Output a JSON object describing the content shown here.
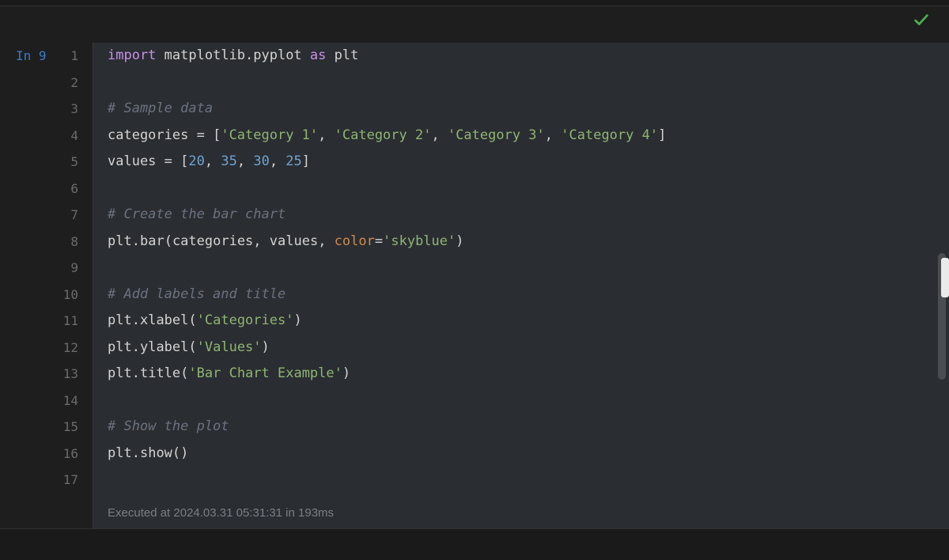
{
  "cell": {
    "prompt": "In 9",
    "execution_status": "Executed at 2024.03.31 05:31:31 in 193ms"
  },
  "gutter": {
    "lines": [
      "1",
      "2",
      "3",
      "4",
      "5",
      "6",
      "7",
      "8",
      "9",
      "10",
      "11",
      "12",
      "13",
      "14",
      "15",
      "16",
      "17"
    ]
  },
  "code": {
    "line1": {
      "kw_import": "import",
      "module": "matplotlib.pyplot",
      "kw_as": "as",
      "alias": "plt"
    },
    "line3": {
      "comment": "# Sample data"
    },
    "line4": {
      "ident": "categories",
      "eq": " = ",
      "br_o": "[",
      "s1": "'Category 1'",
      "c1": ", ",
      "s2": "'Category 2'",
      "c2": ", ",
      "s3": "'Category 3'",
      "c3": ", ",
      "s4": "'Category 4'",
      "br_c": "]"
    },
    "line5": {
      "ident": "values",
      "eq": " = ",
      "br_o": "[",
      "n1": "20",
      "c1": ", ",
      "n2": "35",
      "c2": ", ",
      "n3": "30",
      "c3": ", ",
      "n4": "25",
      "br_c": "]"
    },
    "line7": {
      "comment": "# Create the bar chart"
    },
    "line8": {
      "obj": "plt",
      "dot": ".",
      "fn": "bar",
      "p_o": "(",
      "a1": "categories",
      "c1": ", ",
      "a2": "values",
      "c2": ", ",
      "kwarg": "color",
      "eq": "=",
      "str": "'skyblue'",
      "p_c": ")"
    },
    "line10": {
      "comment": "# Add labels and title"
    },
    "line11": {
      "obj": "plt",
      "dot": ".",
      "fn": "xlabel",
      "p_o": "(",
      "str": "'Categories'",
      "p_c": ")"
    },
    "line12": {
      "obj": "plt",
      "dot": ".",
      "fn": "ylabel",
      "p_o": "(",
      "str": "'Values'",
      "p_c": ")"
    },
    "line13": {
      "obj": "plt",
      "dot": ".",
      "fn": "title",
      "p_o": "(",
      "str": "'Bar Chart Example'",
      "p_c": ")"
    },
    "line15": {
      "comment": "# Show the plot"
    },
    "line16": {
      "obj": "plt",
      "dot": ".",
      "fn": "show",
      "p_o": "(",
      "p_c": ")"
    }
  },
  "chart_data": {
    "type": "bar",
    "categories": [
      "Category 1",
      "Category 2",
      "Category 3",
      "Category 4"
    ],
    "values": [
      20,
      35,
      30,
      25
    ],
    "title": "Bar Chart Example",
    "xlabel": "Categories",
    "ylabel": "Values",
    "color": "skyblue"
  }
}
